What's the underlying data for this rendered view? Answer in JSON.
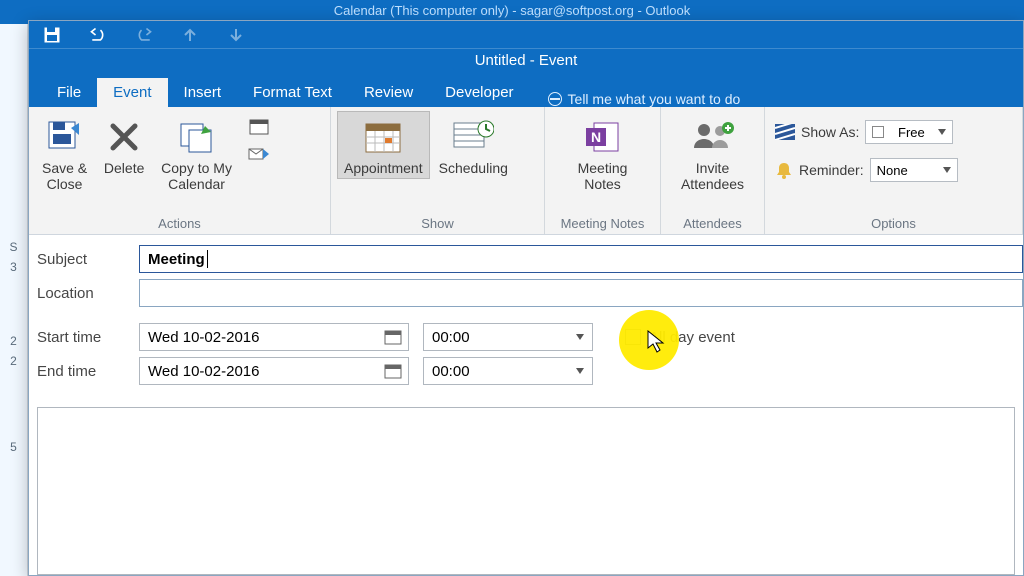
{
  "parent_title": "Calendar (This computer only) - sagar@softpost.org - Outlook",
  "window_title": "Untitled - Event",
  "tabs": {
    "file": "File",
    "event": "Event",
    "insert": "Insert",
    "format_text": "Format Text",
    "review": "Review",
    "developer": "Developer"
  },
  "tellme": "Tell me what you want to do",
  "ribbon": {
    "actions": {
      "save_close": "Save &\nClose",
      "delete": "Delete",
      "copy_cal": "Copy to My\nCalendar",
      "group_label": "Actions"
    },
    "show": {
      "appointment": "Appointment",
      "scheduling": "Scheduling",
      "group_label": "Show"
    },
    "meeting_notes": {
      "btn": "Meeting\nNotes",
      "group_label": "Meeting Notes"
    },
    "attendees": {
      "btn": "Invite\nAttendees",
      "group_label": "Attendees"
    },
    "options": {
      "show_as_label": "Show As:",
      "show_as_value": "Free",
      "reminder_label": "Reminder:",
      "reminder_value": "None",
      "group_label": "Options"
    }
  },
  "form": {
    "subject_label": "Subject",
    "subject_value": "Meeting",
    "location_label": "Location",
    "location_value": "",
    "start_label": "Start time",
    "end_label": "End time",
    "start_date": "Wed 10-02-2016",
    "start_time": "00:00",
    "end_date": "Wed 10-02-2016",
    "end_time": "00:00",
    "all_day": "All day event"
  },
  "sliver": {
    "s": "S",
    "n3": "3",
    "n2a": "2",
    "n2b": "2",
    "n5": "5"
  }
}
